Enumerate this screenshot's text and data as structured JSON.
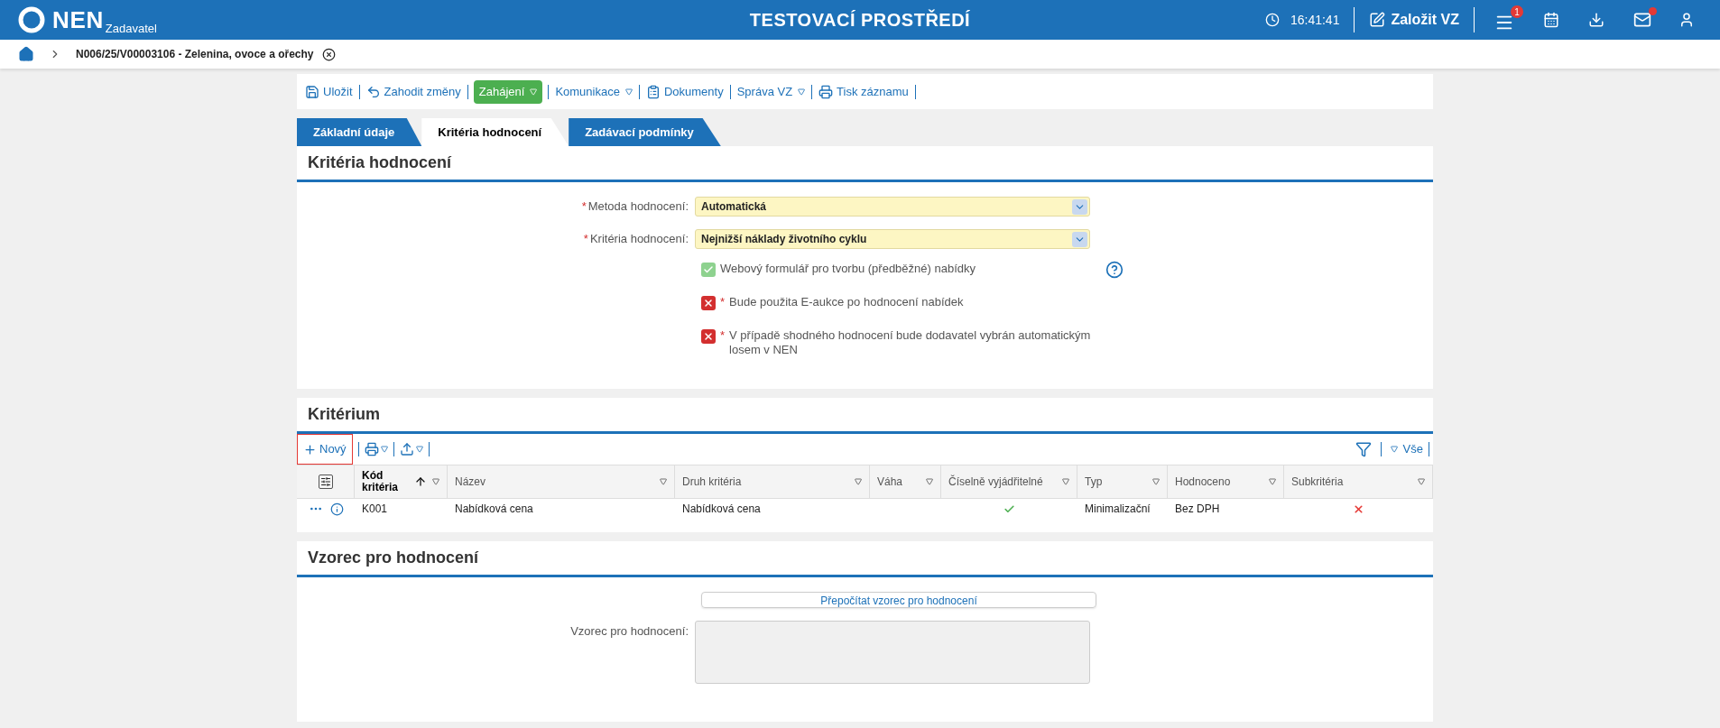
{
  "header": {
    "logo": "NEN",
    "logo_sub": "Zadavatel",
    "title": "TESTOVACÍ PROSTŘEDÍ",
    "time": "16:41:41",
    "create_button": "Založit VZ",
    "menu_badge": "1",
    "mail_unread": true
  },
  "breadcrumb": {
    "text": "N006/25/V00003106 - Zelenina, ovoce a ořechy"
  },
  "toolbar": [
    {
      "label": "Uložit",
      "dropdown": false,
      "highlighted": false
    },
    {
      "label": "Zahodit změny",
      "dropdown": false,
      "highlighted": false
    },
    {
      "label": "Zahájení",
      "dropdown": true,
      "highlighted": true
    },
    {
      "label": "Komunikace",
      "dropdown": true,
      "highlighted": false
    },
    {
      "label": "Dokumenty",
      "dropdown": false,
      "highlighted": false
    },
    {
      "label": "Správa VZ",
      "dropdown": true,
      "highlighted": false
    },
    {
      "label": "Tisk záznamu",
      "dropdown": false,
      "highlighted": false
    }
  ],
  "tabs": [
    {
      "label": "Základní údaje",
      "selected": false
    },
    {
      "label": "Kritéria hodnocení",
      "selected": true
    },
    {
      "label": "Zadávací podmínky",
      "selected": false
    }
  ],
  "criteria_panel": {
    "title": "Kritéria hodnocení",
    "required_symbol": "*",
    "fields": [
      {
        "label": "Metoda hodnocení:",
        "value": "Automatická",
        "required": true
      },
      {
        "label": "Kritéria hodnocení:",
        "value": "Nejnižší náklady životního cyklu",
        "required": true
      }
    ],
    "checks": [
      {
        "label": "Webový formulář pro tvorbu (předběžné) nabídky",
        "enabled": true,
        "required": false,
        "help": true
      },
      {
        "label": "Bude použita E-aukce po hodnocení nabídek",
        "enabled": false,
        "required": true,
        "help": false
      },
      {
        "label": "V případě shodného hodnocení bude dodavatel vybrán automatickým losem v NEN",
        "enabled": false,
        "required": true,
        "help": false
      }
    ]
  },
  "criterion_panel": {
    "title": "Kritérium",
    "new_button": "Nový",
    "filter_all": "Vše",
    "columns": [
      {
        "label": "Kód kritéria",
        "sorted": true
      },
      {
        "label": "Název",
        "sorted": false
      },
      {
        "label": "Druh kritéria",
        "sorted": false
      },
      {
        "label": "Váha",
        "sorted": false
      },
      {
        "label": "Číselně vyjádřitelné",
        "sorted": false
      },
      {
        "label": "Typ",
        "sorted": false
      },
      {
        "label": "Hodnoceno",
        "sorted": false
      },
      {
        "label": "Subkritéria",
        "sorted": false
      }
    ],
    "rows": [
      {
        "code": "K001",
        "name": "Nabídková cena",
        "kind": "Nabídková cena",
        "numeric": true,
        "type": "Minimalizační",
        "evaluated": "Bez DPH",
        "subcriteria": false
      }
    ]
  },
  "formula_panel": {
    "title": "Vzorec pro hodnocení",
    "recalc_button": "Přepočítat vzorec pro hodnocení",
    "field_label": "Vzorec pro hodnocení:"
  }
}
